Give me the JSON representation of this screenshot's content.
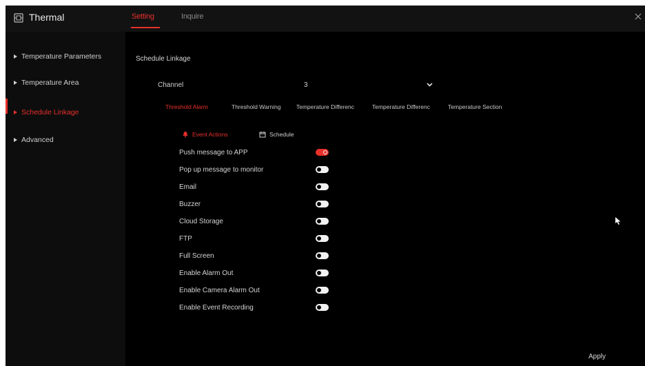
{
  "header": {
    "title": "Thermal",
    "tabs": [
      {
        "label": "Setting",
        "active": true
      },
      {
        "label": "Inquire",
        "active": false
      }
    ]
  },
  "sidebar": {
    "items": [
      {
        "label": "Temperature Parameters",
        "active": false
      },
      {
        "label": "Temperature Area",
        "active": false
      },
      {
        "label": "Schedule Linkage",
        "active": true
      },
      {
        "label": "Advanced",
        "active": false
      }
    ]
  },
  "main": {
    "section_title": "Schedule Linkage",
    "channel": {
      "label": "Channel",
      "value": "3"
    },
    "alarm_tabs": [
      {
        "label": "Threshold Alarm",
        "active": true
      },
      {
        "label": "Threshold Warning",
        "active": false
      },
      {
        "label": "Temperature Differenc",
        "active": false
      },
      {
        "label": "Temperature Differenc",
        "active": false
      },
      {
        "label": "Temperature Section",
        "active": false
      }
    ],
    "action_tabs": [
      {
        "label": "Event Actions",
        "icon": "bell-icon",
        "active": true
      },
      {
        "label": "Schedule",
        "icon": "calendar-icon",
        "active": false
      }
    ],
    "actions": [
      {
        "label": "Push message to APP",
        "enabled": true
      },
      {
        "label": "Pop up message to monitor",
        "enabled": false
      },
      {
        "label": "Email",
        "enabled": false
      },
      {
        "label": "Buzzer",
        "enabled": false
      },
      {
        "label": "Cloud Storage",
        "enabled": false
      },
      {
        "label": "FTP",
        "enabled": false
      },
      {
        "label": "Full Screen",
        "enabled": false
      },
      {
        "label": "Enable Alarm Out",
        "enabled": false
      },
      {
        "label": "Enable Camera Alarm Out",
        "enabled": false
      },
      {
        "label": "Enable Event Recording",
        "enabled": false
      }
    ],
    "apply_label": "Apply"
  },
  "colors": {
    "accent": "#e8302b",
    "background": "#000000",
    "topbar": "#121212",
    "sidebar": "#0d0d0d"
  }
}
